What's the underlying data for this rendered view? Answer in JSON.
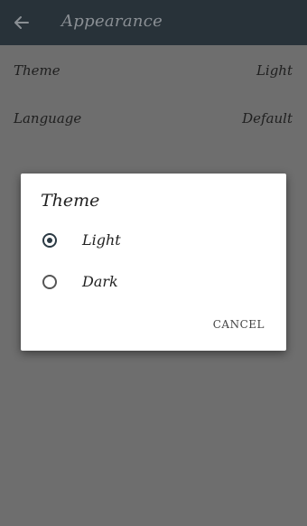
{
  "toolbar": {
    "title": "Appearance",
    "back_icon": "arrow-left-icon"
  },
  "preferences": [
    {
      "label": "Theme",
      "value": "Light"
    },
    {
      "label": "Language",
      "value": "Default"
    }
  ],
  "dialog": {
    "title": "Theme",
    "options": [
      {
        "label": "Light",
        "selected": true
      },
      {
        "label": "Dark",
        "selected": false
      }
    ],
    "cancel_label": "CANCEL"
  },
  "colors": {
    "toolbar": "#283239",
    "scrim_background": "#6e6e6e",
    "dialog": "#ffffff",
    "radio_accent": "#2b3a44"
  }
}
